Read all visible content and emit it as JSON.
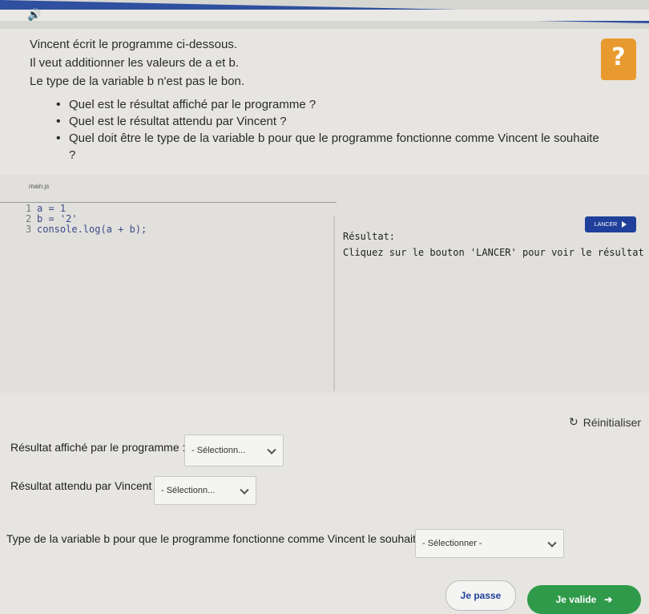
{
  "intro": {
    "line1": "Vincent écrit le programme ci-dessous.",
    "line2": "Il veut additionner les valeurs de a et b.",
    "line3": "Le type de la variable b n'est pas le bon."
  },
  "questions": [
    "Quel est le résultat affiché par le programme ?",
    "Quel est le résultat attendu par Vincent ?",
    "Quel doit être le type de la variable b pour que le programme fonctionne comme Vincent le souhaite ?"
  ],
  "editor": {
    "file_tab": "main.js",
    "lines": [
      {
        "num": "1",
        "code": "a = 1"
      },
      {
        "num": "2",
        "code": "b = '2'"
      },
      {
        "num": "3",
        "code": "console.log(a + b);"
      }
    ],
    "run_label": "LANCER",
    "result_label": "Résultat:",
    "result_text": "Cliquez sur le bouton 'LANCER' pour voir le résultat"
  },
  "reset_label": "Réinitialiser",
  "form": {
    "q1_label": "Résultat affiché par le programme :",
    "q1_value": "- Sélectionn...",
    "q2_label": "Résultat attendu par Vincent :",
    "q2_value": "- Sélectionn...",
    "q3_label": "Type de la variable b pour que le programme fonctionne comme Vincent le souhaite :",
    "q3_value": "- Sélectionner -"
  },
  "buttons": {
    "skip": "Je passe",
    "validate": "Je valide"
  },
  "colors": {
    "accent": "#1f3f9a",
    "help": "#e89a2e",
    "validate": "#2f9a4a"
  }
}
